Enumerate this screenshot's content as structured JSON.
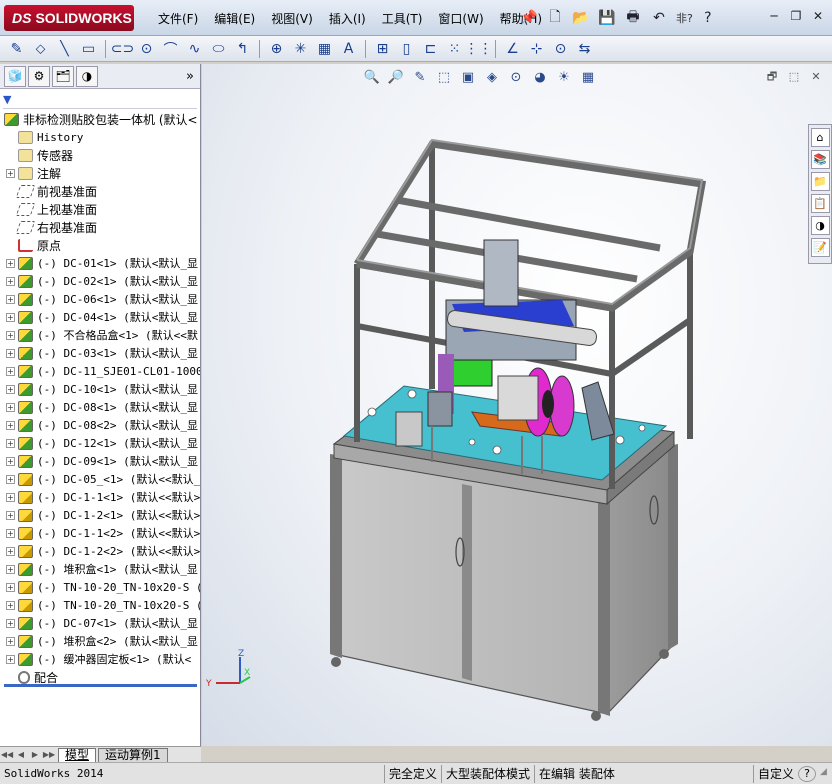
{
  "app": {
    "brand": "SOLIDWORKS",
    "brand_prefix": "DS",
    "status_app": "SolidWorks 2014"
  },
  "menu": [
    "文件(F)",
    "编辑(E)",
    "视图(V)",
    "插入(I)",
    "工具(T)",
    "窗口(W)",
    "帮助(H)"
  ],
  "title_tools": {
    "pin": "📌",
    "new": "🗋",
    "open": "📂",
    "save": "💾",
    "print": "🖶",
    "undo": "↶",
    "search_hint": "非?",
    "help": "?",
    "minimize": "─",
    "restore": "❐",
    "close": "✕"
  },
  "sketch_tools": [
    "✎",
    "⬦",
    "╲",
    "▭",
    "⊂⊃",
    "⊙",
    "⌒",
    "∿",
    "⬭",
    "↰",
    "⊕",
    "✳",
    "▦",
    "A",
    "⊞",
    "▯",
    "⊏",
    "⁙",
    "⋮⋮",
    "∠",
    "⊹",
    "⊙",
    "⇆"
  ],
  "feature_manager": {
    "tabs": [
      "🧊",
      "⚙",
      "🗂",
      "◑"
    ],
    "more": "»",
    "filter": "▼",
    "root_label": "非标检测贴胶包装一体机  (默认<",
    "tree": [
      {
        "expand": "",
        "icon": "folder",
        "label": "History"
      },
      {
        "expand": "",
        "icon": "folder",
        "label": "传感器",
        "cn": true
      },
      {
        "expand": "+",
        "icon": "folder",
        "label": "注解",
        "cn": true
      },
      {
        "expand": "",
        "icon": "plane",
        "label": "前视基准面",
        "cn": true
      },
      {
        "expand": "",
        "icon": "plane",
        "label": "上视基准面",
        "cn": true
      },
      {
        "expand": "",
        "icon": "plane",
        "label": "右视基准面",
        "cn": true
      },
      {
        "expand": "",
        "icon": "origin",
        "label": "原点",
        "cn": true
      },
      {
        "expand": "+",
        "icon": "asm",
        "label": "(-) DC-01<1> (默认<默认_显"
      },
      {
        "expand": "+",
        "icon": "asm",
        "label": "(-) DC-02<1> (默认<默认_显"
      },
      {
        "expand": "+",
        "icon": "asm",
        "label": "(-) DC-06<1> (默认<默认_显"
      },
      {
        "expand": "+",
        "icon": "asm",
        "label": "(-) DC-04<1> (默认<默认_显"
      },
      {
        "expand": "+",
        "icon": "asm",
        "label": "(-) 不合格品盒<1> (默认<<默"
      },
      {
        "expand": "+",
        "icon": "asm",
        "label": "(-) DC-03<1> (默认<默认_显"
      },
      {
        "expand": "+",
        "icon": "asm",
        "label": "(-) DC-11_SJE01-CL01-1000_"
      },
      {
        "expand": "+",
        "icon": "asm",
        "label": "(-) DC-10<1> (默认<默认_显"
      },
      {
        "expand": "+",
        "icon": "asm",
        "label": "(-) DC-08<1> (默认<默认_显"
      },
      {
        "expand": "+",
        "icon": "asm",
        "label": "(-) DC-08<2> (默认<默认_显"
      },
      {
        "expand": "+",
        "icon": "asm",
        "label": "(-) DC-12<1> (默认<默认_显"
      },
      {
        "expand": "+",
        "icon": "asm",
        "label": "(-) DC-09<1> (默认<默认_显"
      },
      {
        "expand": "+",
        "icon": "part",
        "label": "(-) DC-05_<1> (默认<<默认_显"
      },
      {
        "expand": "+",
        "icon": "part",
        "label": "(-) DC-1-1<1> (默认<<默认>"
      },
      {
        "expand": "+",
        "icon": "part",
        "label": "(-) DC-1-2<1> (默认<<默认>"
      },
      {
        "expand": "+",
        "icon": "part",
        "label": "(-) DC-1-1<2> (默认<<默认>"
      },
      {
        "expand": "+",
        "icon": "part",
        "label": "(-) DC-1-2<2> (默认<<默认>"
      },
      {
        "expand": "+",
        "icon": "asm",
        "label": "(-) 堆积盒<1> (默认<默认_显"
      },
      {
        "expand": "+",
        "icon": "part",
        "label": "(-) TN-10-20_TN-10x20-S (C"
      },
      {
        "expand": "+",
        "icon": "part",
        "label": "(-) TN-10-20_TN-10x20-S (C"
      },
      {
        "expand": "+",
        "icon": "asm",
        "label": "(-) DC-07<1> (默认<默认_显"
      },
      {
        "expand": "+",
        "icon": "asm",
        "label": "(-) 堆积盒<2> (默认<默认_显"
      },
      {
        "expand": "+",
        "icon": "asm",
        "label": "(-) 缓冲器固定板<1> (默认<"
      },
      {
        "expand": "",
        "icon": "mate",
        "label": "配合",
        "cn": true
      }
    ],
    "bottom_nav": [
      "◀◀",
      "◀",
      "▶",
      "▶▶"
    ],
    "bottom_tabs": [
      "模型",
      "运动算例1"
    ]
  },
  "heads_up": [
    "🔍",
    "🔎",
    "✎",
    "⬚",
    "▣",
    "◈",
    "⊙",
    "◕",
    "☀",
    "▦"
  ],
  "vp_winctl": [
    "🗗",
    "⬚",
    "✕"
  ],
  "task_pane": [
    "⌂",
    "📚",
    "📁",
    "📋",
    "◑",
    "📝"
  ],
  "triad": {
    "x": "X",
    "y": "Y",
    "z": "Z"
  },
  "status": {
    "cells": [
      "完全定义",
      "大型装配体模式",
      "在编辑 装配体"
    ],
    "custom": "自定义",
    "help": "?"
  }
}
